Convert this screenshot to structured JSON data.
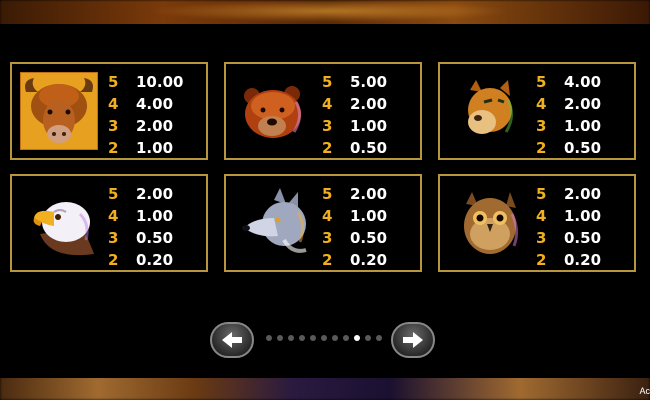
{
  "paytable": {
    "cards": [
      {
        "symbol": "buffalo-icon",
        "rows": [
          {
            "count": "5",
            "pay": "10.00"
          },
          {
            "count": "4",
            "pay": "4.00"
          },
          {
            "count": "3",
            "pay": "2.00"
          },
          {
            "count": "2",
            "pay": "1.00"
          }
        ]
      },
      {
        "symbol": "bear-icon",
        "rows": [
          {
            "count": "5",
            "pay": "5.00"
          },
          {
            "count": "4",
            "pay": "2.00"
          },
          {
            "count": "3",
            "pay": "1.00"
          },
          {
            "count": "2",
            "pay": "0.50"
          }
        ]
      },
      {
        "symbol": "cougar-icon",
        "rows": [
          {
            "count": "5",
            "pay": "4.00"
          },
          {
            "count": "4",
            "pay": "2.00"
          },
          {
            "count": "3",
            "pay": "1.00"
          },
          {
            "count": "2",
            "pay": "0.50"
          }
        ]
      },
      {
        "symbol": "eagle-icon",
        "rows": [
          {
            "count": "5",
            "pay": "2.00"
          },
          {
            "count": "4",
            "pay": "1.00"
          },
          {
            "count": "3",
            "pay": "0.50"
          },
          {
            "count": "2",
            "pay": "0.20"
          }
        ]
      },
      {
        "symbol": "wolf-icon",
        "rows": [
          {
            "count": "5",
            "pay": "2.00"
          },
          {
            "count": "4",
            "pay": "1.00"
          },
          {
            "count": "3",
            "pay": "0.50"
          },
          {
            "count": "2",
            "pay": "0.20"
          }
        ]
      },
      {
        "symbol": "owl-icon",
        "rows": [
          {
            "count": "5",
            "pay": "2.00"
          },
          {
            "count": "4",
            "pay": "1.00"
          },
          {
            "count": "3",
            "pay": "0.50"
          },
          {
            "count": "2",
            "pay": "0.20"
          }
        ]
      }
    ]
  },
  "pagination": {
    "total_pages": 11,
    "current_page": 9,
    "prev_icon": "arrow-left-icon",
    "next_icon": "arrow-right-icon"
  },
  "footer": {
    "corner_text": "Ac"
  },
  "colors": {
    "border": "#b8963c",
    "count": "#f0b020",
    "pay": "#ffffff"
  }
}
